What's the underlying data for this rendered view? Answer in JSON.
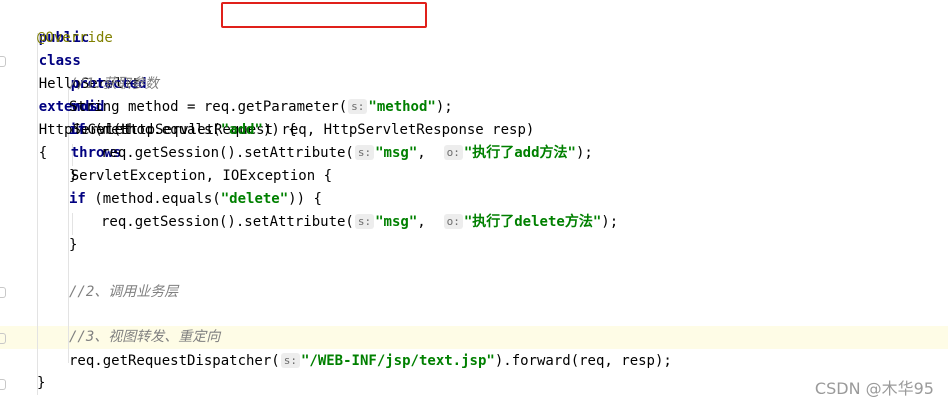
{
  "code": {
    "l1": {
      "kw1": "public",
      "kw2": "class",
      "name": "HelloServlet",
      "ext": "extends",
      "parent": "HttpServlet",
      "brace": "{"
    },
    "l2": {
      "annotation": "@Override"
    },
    "l3": {
      "kw1": "protected",
      "kw2": "void",
      "sig": "doGet(HttpServletRequest req, HttpServletResponse resp)",
      "throws": "throws",
      "exc": "ServletException, IOException {"
    },
    "l4": {
      "comment": "//1.获取参数"
    },
    "l5": {
      "pre": "String method = req.getParameter(",
      "hint": "s:",
      "str": "\"method\"",
      "post": ");"
    },
    "l6": {
      "kw": "if",
      "pre": "(method.equals(",
      "str": "\"add\"",
      "post": ")) {"
    },
    "l7": {
      "pre": "req.getSession().setAttribute(",
      "hint1": "s:",
      "str1": "\"msg\"",
      "mid": ",",
      "hint2": "o:",
      "str2": "\"执行了add方法\"",
      "post": ");"
    },
    "l8": {
      "text": "}"
    },
    "l9": {
      "kw": "if",
      "pre": "(method.equals(",
      "str": "\"delete\"",
      "post": ")) {"
    },
    "l10": {
      "pre": "req.getSession().setAttribute(",
      "hint1": "s:",
      "str1": "\"msg\"",
      "mid": ",",
      "hint2": "o:",
      "str2": "\"执行了delete方法\"",
      "post": ");"
    },
    "l11": {
      "text": "}"
    },
    "l12": {
      "comment": "//2、调用业务层"
    },
    "l13": {
      "comment": "//3、视图转发、重定向"
    },
    "l14": {
      "pre": "req.getRequestDispatcher(",
      "hint": "s:",
      "str": "\"/WEB-INF/jsp/text.jsp\"",
      "post": ").forward(req, resp);"
    },
    "l15": {
      "text": "}"
    }
  },
  "watermark": "CSDN @木华95",
  "colors": {
    "keyword": "#000080",
    "string": "#008000",
    "comment": "#808080",
    "annotation": "#808000",
    "highlight_box": "#e0201a",
    "current_line": "#fefce6"
  }
}
